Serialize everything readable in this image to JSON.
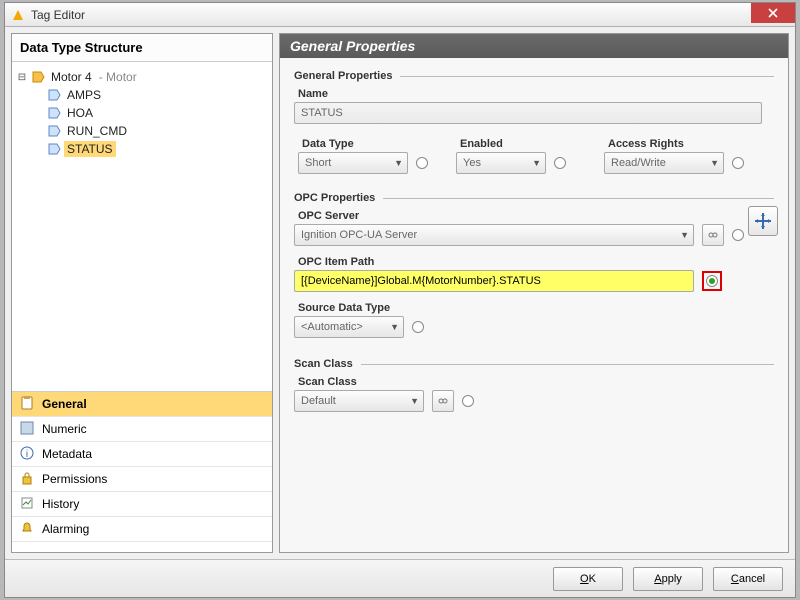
{
  "window": {
    "title": "Tag Editor"
  },
  "tree": {
    "title": "Data Type Structure",
    "root": {
      "label": "Motor 4",
      "type": "Motor"
    },
    "children": [
      "AMPS",
      "HOA",
      "RUN_CMD",
      "STATUS"
    ],
    "selected": "STATUS"
  },
  "tabs": [
    {
      "id": "general",
      "label": "General",
      "selected": true
    },
    {
      "id": "numeric",
      "label": "Numeric"
    },
    {
      "id": "metadata",
      "label": "Metadata"
    },
    {
      "id": "permissions",
      "label": "Permissions"
    },
    {
      "id": "history",
      "label": "History"
    },
    {
      "id": "alarming",
      "label": "Alarming"
    }
  ],
  "panel": {
    "title": "General Properties",
    "general": {
      "group": "General Properties",
      "name_label": "Name",
      "name_value": "STATUS",
      "datatype_label": "Data Type",
      "datatype_value": "Short",
      "enabled_label": "Enabled",
      "enabled_value": "Yes",
      "access_label": "Access Rights",
      "access_value": "Read/Write"
    },
    "opc": {
      "group": "OPC Properties",
      "server_label": "OPC Server",
      "server_value": "Ignition OPC-UA Server",
      "path_label": "OPC Item Path",
      "path_value": "[{DeviceName}]Global.M{MotorNumber}.STATUS",
      "source_label": "Source Data Type",
      "source_value": "<Automatic>"
    },
    "scan": {
      "group": "Scan Class",
      "label": "Scan Class",
      "value": "Default"
    }
  },
  "buttons": {
    "ok": "OK",
    "apply": "Apply",
    "cancel": "Cancel"
  },
  "colors": {
    "highlight": "#ffd877",
    "yellowField": "#ffff66",
    "redFrame": "#d00"
  }
}
